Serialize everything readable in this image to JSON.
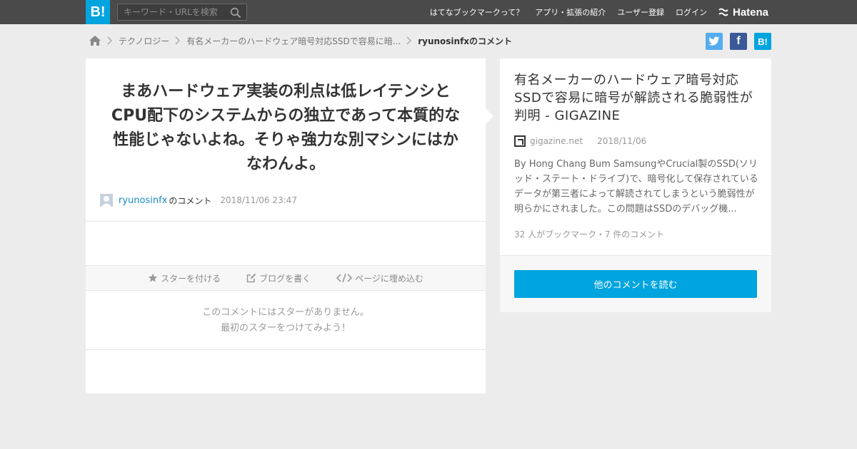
{
  "header": {
    "logo_text": "B!",
    "search_placeholder": "キーワード・URLを検索",
    "nav": [
      "はてなブックマークって？",
      "アプリ・拡張の紹介",
      "ユーザー登録",
      "ログイン"
    ],
    "brand": "Hatena",
    "colors": {
      "bar": "#4a4a4a",
      "accent": "#00a4de"
    }
  },
  "breadcrumb": {
    "home_icon": "home-icon",
    "items": [
      "テクノロジー",
      "有名メーカーのハードウェア暗号対応SSDで容易に暗..."
    ],
    "current": "ryunosinfxのコメント"
  },
  "share": {
    "twitter_icon": "twitter-icon",
    "facebook_label": "f",
    "hatena_label": "B!"
  },
  "comment": {
    "text": "まあハードウェア実装の利点は低レイテンシとCPU配下のシステムからの独立であって本質的な性能じゃないよね。そりゃ強力な別マシンにはかなわんよ。",
    "user": "ryunosinfx",
    "user_suffix": "のコメント",
    "datetime": "2018/11/06 23:47"
  },
  "actions": {
    "star": "スターを付ける",
    "blog": "ブログを書く",
    "embed": "ページに埋め込む"
  },
  "no_star": {
    "line1": "このコメントにはスターがありません。",
    "line2": "最初のスターをつけてみよう！"
  },
  "entry": {
    "title": "有名メーカーのハードウェア暗号対応SSDで容易に暗号が解読される脆弱性が判明 - GIGAZINE",
    "domain": "gigazine.net",
    "date": "2018/11/06",
    "description": "By Hong Chang Bum SamsungやCrucial製のSSD(ソリッド・ステート・ドライブ)で、暗号化して保存されているデータが第三者によって解読されてしまうという脆弱性が明らかにされました。この問題はSSDのデバッグ機...",
    "count": "32 人がブックマーク・7 件のコメント"
  },
  "read_more": "他のコメントを読む"
}
